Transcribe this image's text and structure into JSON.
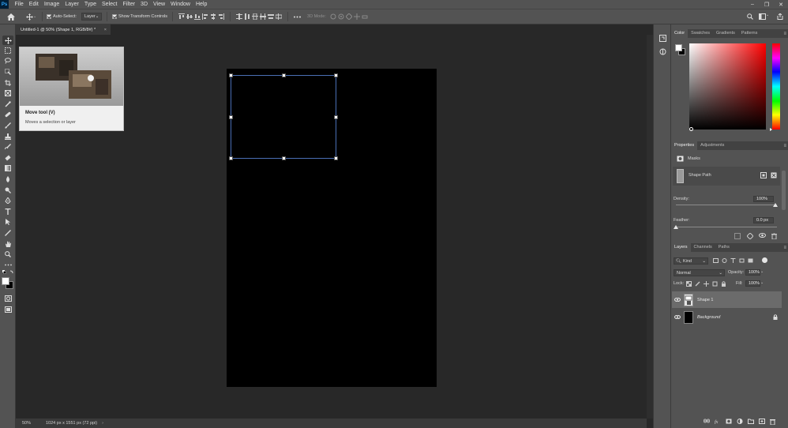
{
  "app": {
    "logo": "Ps"
  },
  "menu": [
    "File",
    "Edit",
    "Image",
    "Layer",
    "Type",
    "Select",
    "Filter",
    "3D",
    "View",
    "Window",
    "Help"
  ],
  "window_controls": [
    "–",
    "❐",
    "✕"
  ],
  "options_bar": {
    "auto_select_label": "Auto-Select:",
    "auto_select_target": "Layer",
    "show_transform_label": "Show Transform Controls",
    "mode_3d_label": "3D Mode:"
  },
  "document_tab": {
    "title": "Untitled-1 @ 50% (Shape 1, RGB/8#) *",
    "close": "×"
  },
  "tooltip": {
    "title": "Move tool (V)",
    "description": "Moves a selection or layer"
  },
  "status": {
    "zoom": "50%",
    "doc_info": "1024 px x 1551 px (72 ppi)"
  },
  "color_panel": {
    "tabs": [
      "Color",
      "Swatches",
      "Gradients",
      "Patterns"
    ],
    "foreground": "#ffffff",
    "background": "#000000"
  },
  "properties_panel": {
    "tabs": [
      "Properties",
      "Adjustments"
    ],
    "masks_label": "Masks",
    "shape_path_label": "Shape Path",
    "density_label": "Density:",
    "density_value": "100%",
    "feather_label": "Feather:",
    "feather_value": "0.0 px"
  },
  "layers_panel": {
    "tabs": [
      "Layers",
      "Channels",
      "Paths"
    ],
    "filter_kind": "Kind",
    "blend_mode": "Normal",
    "opacity_label": "Opacity:",
    "opacity_value": "100%",
    "lock_label": "Lock:",
    "fill_label": "Fill:",
    "fill_value": "100%",
    "layers": [
      {
        "name": "Shape 1",
        "selected": true
      },
      {
        "name": "Background",
        "selected": false
      }
    ]
  }
}
